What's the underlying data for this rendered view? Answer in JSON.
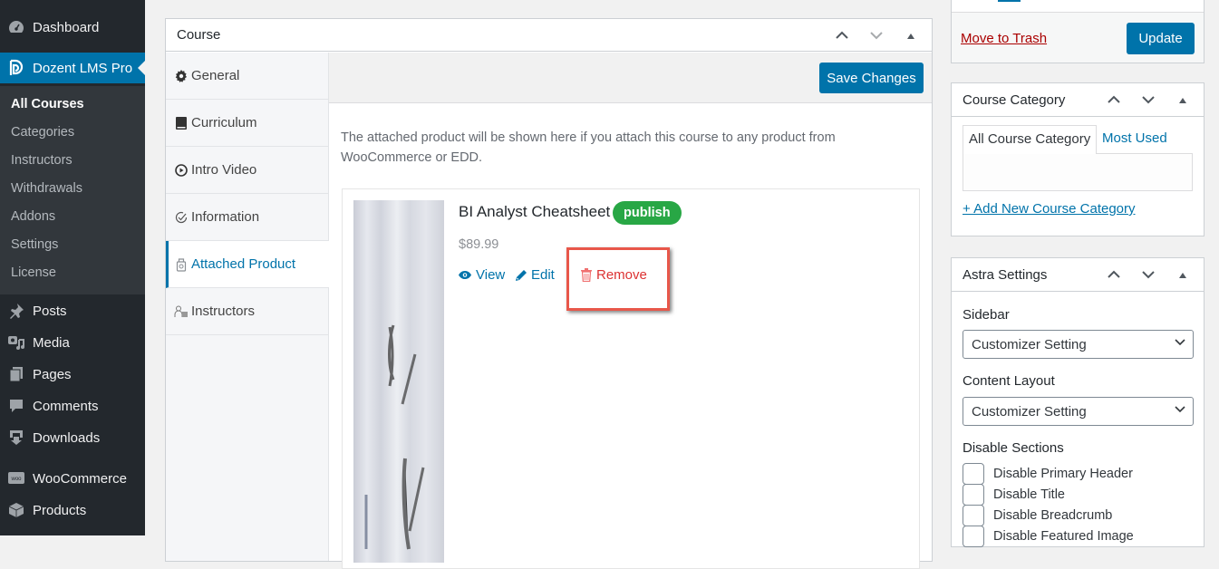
{
  "admin_menu": {
    "dashboard": "Dashboard",
    "dozent": "Dozent LMS Pro",
    "submenu": [
      "All Courses",
      "Categories",
      "Instructors",
      "Withdrawals",
      "Addons",
      "Settings",
      "License"
    ],
    "items": [
      {
        "label": "Posts",
        "icon": "pin-icon"
      },
      {
        "label": "Media",
        "icon": "media-icon"
      },
      {
        "label": "Pages",
        "icon": "pages-icon"
      },
      {
        "label": "Comments",
        "icon": "comment-icon"
      },
      {
        "label": "Downloads",
        "icon": "download-icon"
      },
      {
        "label": "WooCommerce",
        "icon": "woo-icon"
      },
      {
        "label": "Products",
        "icon": "box-icon"
      }
    ]
  },
  "course_box": {
    "title": "Course",
    "tabs": [
      {
        "label": "General",
        "icon": "gear-icon"
      },
      {
        "label": "Curriculum",
        "icon": "book-icon"
      },
      {
        "label": "Intro Video",
        "icon": "play-circle-icon"
      },
      {
        "label": "Information",
        "icon": "check-circle-icon"
      },
      {
        "label": "Attached Product",
        "icon": "product-icon",
        "active": true
      },
      {
        "label": "Instructors",
        "icon": "instructors-icon"
      }
    ],
    "save_label": "Save Changes",
    "description": "The attached product will be shown here if you attach this course to any product from WooCommerce or EDD.",
    "product": {
      "name": "BI Analyst Cheatsheet",
      "status": "publish",
      "price": "$89.99",
      "view": "View",
      "edit": "Edit",
      "remove": "Remove"
    }
  },
  "publish_box": {
    "trash": "Move to Trash",
    "update": "Update"
  },
  "category_box": {
    "title": "Course Category",
    "tab_all": "All Course Category",
    "tab_most": "Most Used",
    "add_new": "+ Add New Course Category"
  },
  "astra_box": {
    "title": "Astra Settings",
    "sidebar_label": "Sidebar",
    "sidebar_value": "Customizer Setting",
    "layout_label": "Content Layout",
    "layout_value": "Customizer Setting",
    "disable_label": "Disable Sections",
    "options": [
      "Disable Primary Header",
      "Disable Title",
      "Disable Breadcrumb",
      "Disable Featured Image"
    ]
  },
  "colors": {
    "accent": "#0073aa",
    "publish": "#28a745",
    "danger": "#dc3232",
    "highlight": "#e74c3c"
  }
}
